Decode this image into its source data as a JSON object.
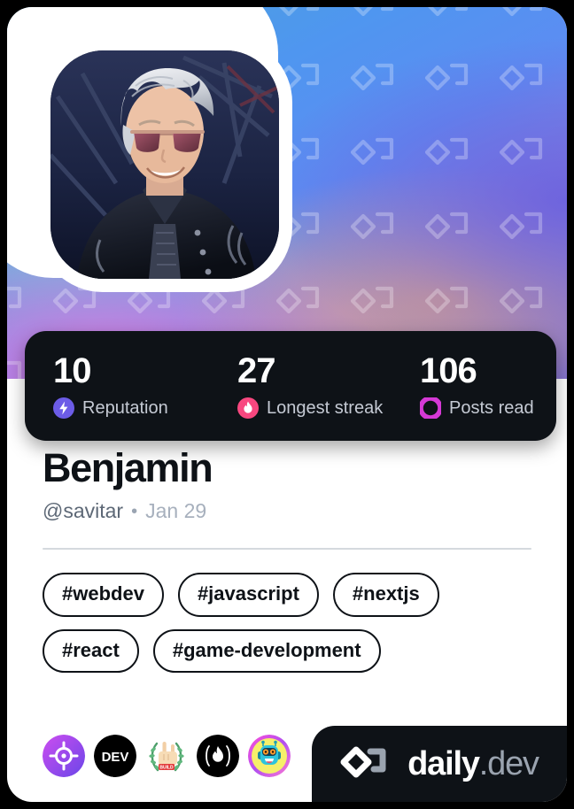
{
  "card": {
    "avatar_alt": "profile-picture",
    "cover_pattern": "daily-dev-chevron-watermark"
  },
  "stats": [
    {
      "value": "10",
      "label": "Reputation",
      "icon": "bolt-icon",
      "color": "#6c5ce7"
    },
    {
      "value": "27",
      "label": "Longest streak",
      "icon": "flame-icon",
      "color": "#f8477f"
    },
    {
      "value": "106",
      "label": "Posts read",
      "icon": "ring-icon",
      "color": "#d539d5"
    }
  ],
  "profile": {
    "name": "Benjamin",
    "handle": "@savitar",
    "separator": "•",
    "joined": "Jan 29"
  },
  "tags": [
    "#webdev",
    "#javascript",
    "#nextjs",
    "#react",
    "#game-development"
  ],
  "badges": [
    {
      "name": "target-badge-icon",
      "title": "target"
    },
    {
      "name": "dev-badge-icon",
      "title": "DEV",
      "text": "DEV"
    },
    {
      "name": "laurel-badge-icon",
      "title": "laurel rock-on"
    },
    {
      "name": "flame-badge-icon",
      "title": "flame"
    },
    {
      "name": "robot-badge-icon",
      "title": "robot"
    }
  ],
  "brand": {
    "logo": "daily-dev-logo-icon",
    "name": "daily",
    "tld": ".dev"
  },
  "colors": {
    "dark": "#0e1217",
    "card": "#ffffff",
    "muted": "#8a96a7",
    "divider": "#d5d9de"
  }
}
